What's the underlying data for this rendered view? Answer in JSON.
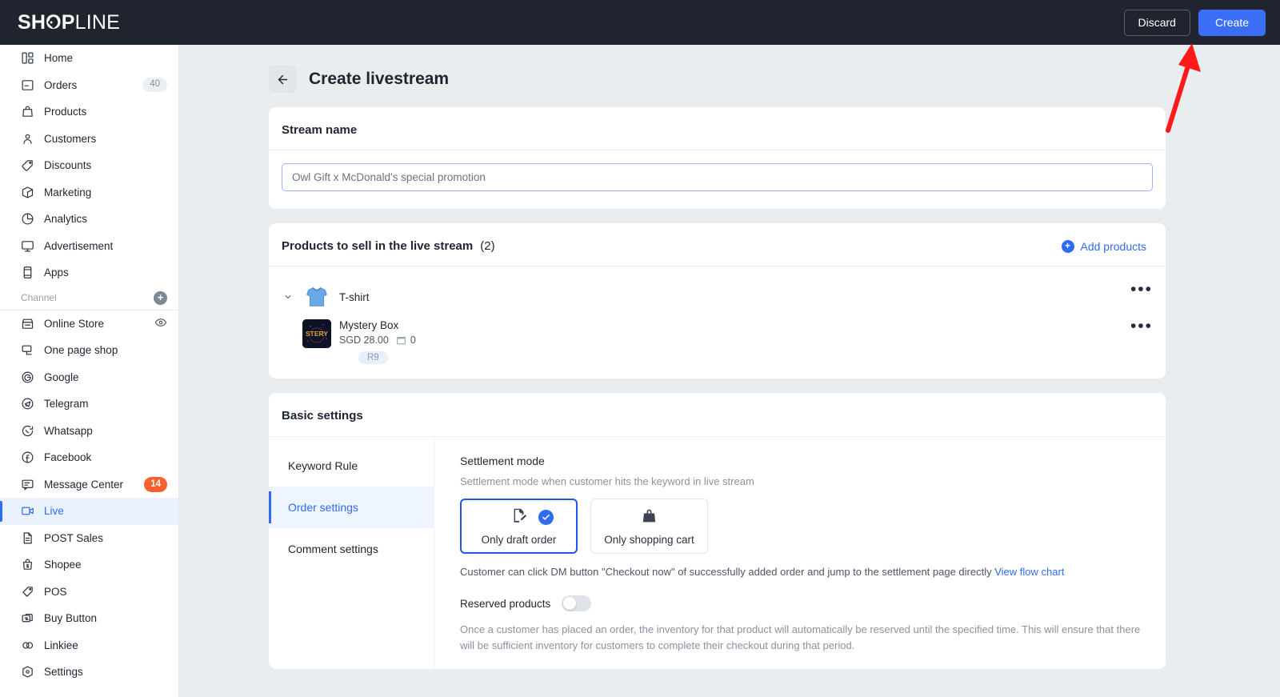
{
  "brand": {
    "name_bold": "SH",
    "name_bold2": "P",
    "name_light": "LINE",
    "o_letter": "O"
  },
  "topbar": {
    "discard_label": "Discard",
    "create_label": "Create",
    "create_color": "#3b6ef5"
  },
  "sidebar": {
    "items": [
      {
        "label": "Home",
        "icon": "dashboard-icon",
        "badge": null
      },
      {
        "label": "Orders",
        "icon": "orders-icon",
        "badge": "40",
        "badge_type": "count"
      },
      {
        "label": "Products",
        "icon": "bag-icon",
        "badge": null
      },
      {
        "label": "Customers",
        "icon": "person-icon",
        "badge": null
      },
      {
        "label": "Discounts",
        "icon": "tag-icon",
        "badge": null
      },
      {
        "label": "Marketing",
        "icon": "cube-icon",
        "badge": null
      },
      {
        "label": "Analytics",
        "icon": "pie-chart-icon",
        "badge": null
      },
      {
        "label": "Advertisement",
        "icon": "monitor-icon",
        "badge": null
      },
      {
        "label": "Apps",
        "icon": "apps-icon",
        "badge": null
      }
    ],
    "channel_header": "Channel",
    "channel_items": [
      {
        "label": "Online Store",
        "icon": "store-icon",
        "trailing": "eye-icon"
      },
      {
        "label": "One page shop",
        "icon": "one-page-shop-icon"
      },
      {
        "label": "Google",
        "icon": "google-icon"
      },
      {
        "label": "Telegram",
        "icon": "telegram-icon"
      },
      {
        "label": "Whatsapp",
        "icon": "whatsapp-icon"
      },
      {
        "label": "Facebook",
        "icon": "facebook-icon"
      },
      {
        "label": "Message Center",
        "icon": "message-icon",
        "badge": "14",
        "badge_type": "alert"
      },
      {
        "label": "Live",
        "icon": "live-icon",
        "active": true
      },
      {
        "label": "POST Sales",
        "icon": "document-icon"
      },
      {
        "label": "Shopee",
        "icon": "shopee-icon"
      },
      {
        "label": "POS",
        "icon": "pos-icon"
      },
      {
        "label": "Buy Button",
        "icon": "buy-button-icon"
      },
      {
        "label": "Linkiee",
        "icon": "linkiee-icon"
      },
      {
        "label": "Settings",
        "icon": "settings-icon"
      }
    ]
  },
  "page": {
    "title": "Create livestream",
    "back_icon": "arrow-left-icon"
  },
  "stream_name": {
    "title": "Stream name",
    "placeholder": "Owl Gift x McDonald's special promotion",
    "value": ""
  },
  "products": {
    "title": "Products to sell in the live stream",
    "count": "(2)",
    "add_label": "Add products",
    "items": [
      {
        "name": "T-shirt",
        "thumb": "tshirt-image",
        "expandable": true,
        "price": "",
        "stock": "",
        "variant": ""
      },
      {
        "name": "Mystery Box",
        "thumb": "mystery-box-image",
        "expandable": false,
        "price": "SGD 28.00",
        "stock": "0",
        "variant": "R9"
      }
    ]
  },
  "basic_settings": {
    "title": "Basic settings",
    "tabs": [
      {
        "label": "Keyword Rule",
        "active": false
      },
      {
        "label": "Order settings",
        "active": true
      },
      {
        "label": "Comment settings",
        "active": false
      }
    ],
    "panel": {
      "title": "Settlement mode",
      "subtitle": "Settlement mode when customer hits the keyword in live stream",
      "options": [
        {
          "label": "Only draft order",
          "icon": "draft-order-icon",
          "selected": true
        },
        {
          "label": "Only shopping cart",
          "icon": "shopping-bag-icon",
          "selected": false
        }
      ],
      "helper_text": "Customer can click DM button \"Checkout now\" of successfully added order and jump to the settlement page directly ",
      "helper_link": "View flow chart",
      "reserved_label": "Reserved products",
      "reserved_enabled": false,
      "reserved_desc": "Once a customer has placed an order, the inventory for that product will automatically be reserved until the specified time. This will ensure that there will be sufficient inventory for customers to complete their checkout during that period."
    }
  },
  "annotation": {
    "arrow_color": "#ff1a1a",
    "target": "create-button"
  }
}
